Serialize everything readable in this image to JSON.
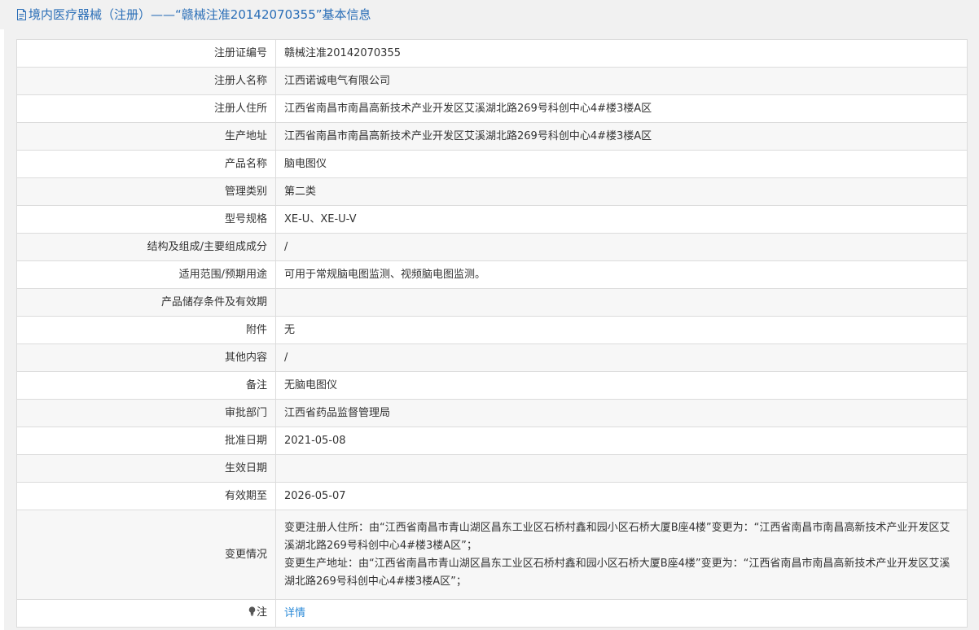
{
  "header": {
    "title": "境内医疗器械（注册）——“赣械注准20142070355”基本信息",
    "icon": "document-icon"
  },
  "colors": {
    "accent": "#2a6eb7",
    "link": "#2a8ad8",
    "border": "#dcdcdc",
    "row_alt": "#f7f7f7",
    "background": "#f1f1f1"
  },
  "rows": [
    {
      "label": "注册证编号",
      "value": "赣械注准20142070355"
    },
    {
      "label": "注册人名称",
      "value": "江西诺诚电气有限公司"
    },
    {
      "label": "注册人住所",
      "value": "江西省南昌市南昌高新技术产业开发区艾溪湖北路269号科创中心4#楼3楼A区"
    },
    {
      "label": "生产地址",
      "value": "江西省南昌市南昌高新技术产业开发区艾溪湖北路269号科创中心4#楼3楼A区"
    },
    {
      "label": "产品名称",
      "value": "脑电图仪"
    },
    {
      "label": "管理类别",
      "value": "第二类"
    },
    {
      "label": "型号规格",
      "value": "XE-U、XE-U-V"
    },
    {
      "label": "结构及组成/主要组成成分",
      "value": "/"
    },
    {
      "label": "适用范围/预期用途",
      "value": "可用于常规脑电图监测、视频脑电图监测。"
    },
    {
      "label": "产品储存条件及有效期",
      "value": ""
    },
    {
      "label": "附件",
      "value": "无"
    },
    {
      "label": "其他内容",
      "value": "/"
    },
    {
      "label": "备注",
      "value": "无脑电图仪"
    },
    {
      "label": "审批部门",
      "value": "江西省药品监督管理局"
    },
    {
      "label": "批准日期",
      "value": "2021-05-08"
    },
    {
      "label": "生效日期",
      "value": ""
    },
    {
      "label": "有效期至",
      "value": "2026-05-07"
    }
  ],
  "changes": {
    "label": "变更情况",
    "lines": [
      "变更注册人住所：由“江西省南昌市青山湖区昌东工业区石桥村鑫和园小区石桥大厦B座4楼”变更为：“江西省南昌市南昌高新技术产业开发区艾溪湖北路269号科创中心4#楼3楼A区”；",
      "变更生产地址：由“江西省南昌市青山湖区昌东工业区石桥村鑫和园小区石桥大厦B座4楼”变更为：“江西省南昌市南昌高新技术产业开发区艾溪湖北路269号科创中心4#楼3楼A区”；"
    ]
  },
  "note": {
    "label": "注",
    "icon": "lightbulb-icon",
    "link_text": "详情"
  }
}
